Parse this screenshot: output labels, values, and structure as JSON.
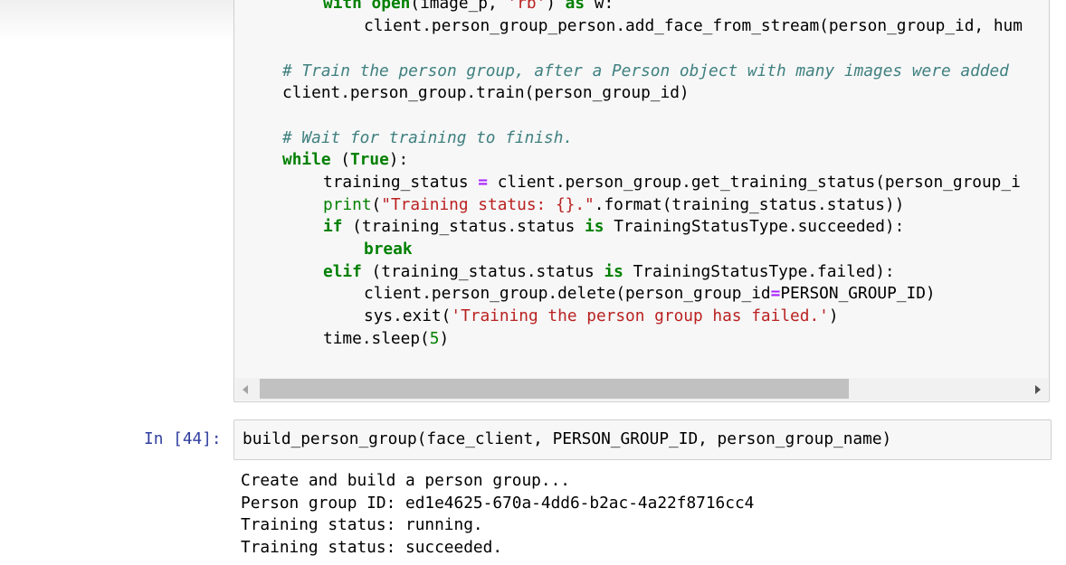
{
  "code_cell": {
    "lines": [
      {
        "id": "l1",
        "parts": [
          [
            "kw",
            "with "
          ],
          [
            "kw",
            "open"
          ],
          [
            "",
            "(image_p, "
          ],
          [
            "str",
            "'rb'"
          ],
          [
            "",
            ") "
          ],
          [
            "kw",
            "as"
          ],
          [
            "",
            " w:"
          ]
        ]
      },
      {
        "id": "l2",
        "parts": [
          [
            "",
            "client.person_group_person.add_face_from_stream(person_group_id, hum"
          ]
        ]
      },
      {
        "id": "l3",
        "parts": [
          [
            "cmt",
            "# Train the person group, after a Person object with many images were added"
          ]
        ]
      },
      {
        "id": "l4",
        "parts": [
          [
            "",
            "client.person_group.train(person_group_id)"
          ]
        ]
      },
      {
        "id": "l5",
        "parts": [
          [
            "cmt",
            "# Wait for training to finish."
          ]
        ]
      },
      {
        "id": "l6",
        "parts": [
          [
            "kw",
            "while"
          ],
          [
            "",
            " ("
          ],
          [
            "kw",
            "True"
          ],
          [
            "",
            "):"
          ]
        ]
      },
      {
        "id": "l7",
        "parts": [
          [
            "",
            "training_status "
          ],
          [
            "op",
            "="
          ],
          [
            "",
            " client.person_group.get_training_status(person_group_i"
          ]
        ]
      },
      {
        "id": "l8",
        "parts": [
          [
            "builtin",
            "print"
          ],
          [
            "",
            "("
          ],
          [
            "str",
            "\"Training status: {}.\""
          ],
          [
            "",
            ".format(training_status.status))"
          ]
        ]
      },
      {
        "id": "l9",
        "parts": [
          [
            "kw",
            "if"
          ],
          [
            "",
            " (training_status.status "
          ],
          [
            "kw",
            "is"
          ],
          [
            "",
            " TrainingStatusType.succeeded):"
          ]
        ]
      },
      {
        "id": "l10",
        "parts": [
          [
            "kw",
            "break"
          ]
        ]
      },
      {
        "id": "l11",
        "parts": [
          [
            "kw",
            "elif"
          ],
          [
            "",
            " (training_status.status "
          ],
          [
            "kw",
            "is"
          ],
          [
            "",
            " TrainingStatusType.failed):"
          ]
        ]
      },
      {
        "id": "l12",
        "parts": [
          [
            "",
            "client.person_group.delete(person_group_id"
          ],
          [
            "op",
            "="
          ],
          [
            "",
            "PERSON_GROUP_ID)"
          ]
        ]
      },
      {
        "id": "l13",
        "parts": [
          [
            "",
            "sys.exit("
          ],
          [
            "str",
            "'Training the person group has failed.'"
          ],
          [
            "",
            ")"
          ]
        ]
      },
      {
        "id": "l14",
        "parts": [
          [
            "",
            "time.sleep("
          ],
          [
            "num",
            "5"
          ],
          [
            "",
            ")"
          ]
        ]
      }
    ]
  },
  "input_cell": {
    "prompt": "In [44]:",
    "code": "build_person_group(face_client, PERSON_GROUP_ID, person_group_name)"
  },
  "output": {
    "lines": [
      "Create and build a person group...",
      "Person group ID: ed1e4625-670a-4dd6-b2ac-4a22f8716cc4",
      "Training status: running.",
      "Training status: succeeded."
    ]
  },
  "colors": {
    "keyword": "#008000",
    "string": "#ba2121",
    "comment": "#408080",
    "operator": "#aa22ff",
    "prompt": "#303f9f",
    "cell_bg": "#f7f7f7",
    "cell_border": "#cfcfcf"
  },
  "scrollbar": {
    "left_arrow_icon": "triangle-left-icon",
    "right_arrow_icon": "triangle-right-icon"
  }
}
